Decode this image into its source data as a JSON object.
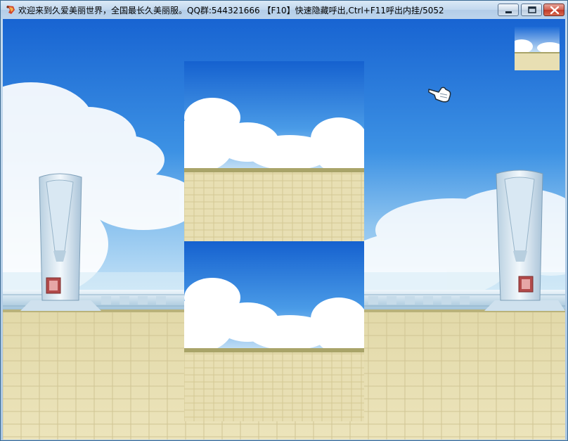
{
  "window": {
    "title": "欢迎来到久爱美丽世界，全国最长久美丽服。QQ群:544321666 【F10】快速隐藏呼出,Ctrl+F11呼出内挂/5052",
    "controls": {
      "minimize": "minimize",
      "maximize": "maximize",
      "close": "close"
    }
  },
  "icons": {
    "app": "game-logo-icon",
    "cursor": "pointing-hand-cursor-icon"
  },
  "colors": {
    "sky_top": "#1a6fd6",
    "sky_mid": "#4a9ae6",
    "cloud": "#ffffff",
    "floor": "#e6dcb0",
    "floor_grid": "#cfc391",
    "horizon_band": "#a8a268",
    "tower": "#dbe9f3"
  }
}
